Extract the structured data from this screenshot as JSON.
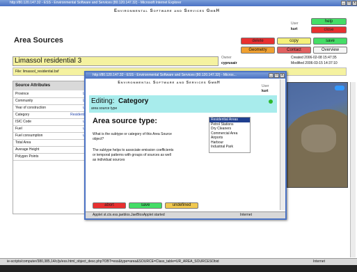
{
  "browser": {
    "title": "http://80.120.147.32 - ESS - Environmental Software and Services (80.120.147.32) - Microsoft Internet Explorer",
    "statusbar_url": "ie-scripts/computer/380,385,14/c/js/ess.html_object_desc.php?OBT=ess&type=area&SOURCE=Class_table=UR_AREA_SOURCESObid",
    "statusbar_zone": "Internet"
  },
  "header": {
    "company": "Environmental Software and Services GmbH",
    "user_label": "User",
    "user_name": "kurt"
  },
  "buttons": {
    "help": "help",
    "close": "close",
    "delete": "delete",
    "copy": "copy",
    "save": "save",
    "geometry": "Geometry",
    "contact": "Contact",
    "overview": "Overview"
  },
  "page": {
    "title": "Area Sources",
    "record_name": "Limassol residential 3",
    "owner_label": "Owner",
    "owner_value": "cyprusair",
    "created_label": "Created 2006-02-08 15:47:35",
    "modified_label": "Modified 2006-03-15 14:37:10",
    "file_label": "File: limassol_residential.bsf"
  },
  "attributes": {
    "header": "Source Attributes",
    "rows": [
      {
        "label": "Province",
        "value": "L"
      },
      {
        "label": "Community",
        "value": "L"
      },
      {
        "label": "Year of construction",
        "value": "u"
      },
      {
        "label": "Category",
        "value": "Residenti"
      },
      {
        "label": "ISIC Code",
        "value": "u"
      },
      {
        "label": "Fuel",
        "value": "u"
      },
      {
        "label": "Fuel consumption",
        "value": "u"
      },
      {
        "label": "Total Area",
        "value": ""
      },
      {
        "label": "Average Height",
        "value": ""
      },
      {
        "label": "Polygon Points",
        "value": ""
      }
    ]
  },
  "popup": {
    "title": "http://80.120.147.32 - ESS - Environmental Software and Services (80.120.147.32) - Micros...",
    "company": "Environmental Software and Services GmbH",
    "user_label": "User",
    "user_name": "kurt",
    "editing_prefix": "Editing:",
    "editing_field": "Category",
    "editing_sub": "area source type",
    "heading": "Area source type:",
    "question": "What is the subtype or category of this Area Source object?",
    "help_text": "The subtype helps to associate emission coefficients or temporal patterns with groups of sources as well as individual sources",
    "options": [
      "Residential Areas",
      "Petrol Stations",
      "Dry Cleaners",
      "Commercial Area",
      "Airports",
      "Harbour",
      "Industrial Park"
    ],
    "selected_option": "Residential Areas",
    "btn_abort": "abort",
    "btn_save": "save",
    "btn_undefined": "undefined",
    "status_text": "Applet st.ctx.ess.jaeblos.JaeBlosApplet started",
    "status_zone": "Internet"
  },
  "colors": {
    "titlebar": "#4a72c4",
    "help_btn": "#44dd66",
    "close_btn": "#e83030",
    "copy_btn": "#f5f07a",
    "geometry_btn": "#f0a030",
    "contact_btn": "#e06060",
    "record_bar": "#f5f2a0",
    "editing_bar": "#a8ecec"
  }
}
